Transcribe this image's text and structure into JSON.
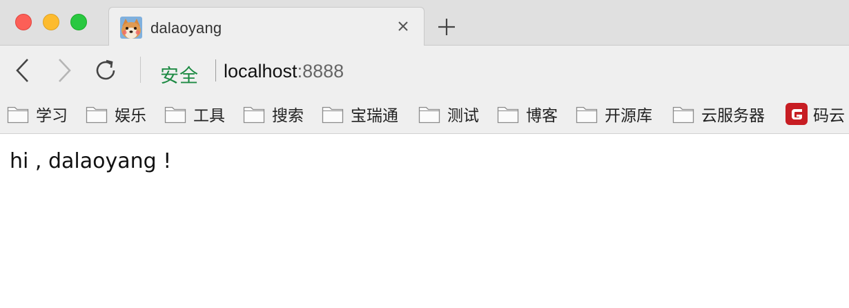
{
  "tab": {
    "title": "dalaoyang",
    "close_symbol": "×",
    "favicon": "shiba-dog-favicon"
  },
  "new_tab_symbol": "+",
  "toolbar": {
    "back_icon": "chevron-left-icon",
    "forward_icon": "chevron-right-icon",
    "reload_icon": "reload-icon"
  },
  "omnibox": {
    "security_label": "安全",
    "url_host": "localhost",
    "url_port": ":8888"
  },
  "bookmarks": [
    {
      "label": "学习",
      "icon": "folder-icon"
    },
    {
      "label": "娱乐",
      "icon": "folder-icon"
    },
    {
      "label": "工具",
      "icon": "folder-icon"
    },
    {
      "label": "搜索",
      "icon": "folder-icon"
    },
    {
      "label": "宝瑞通",
      "icon": "folder-icon"
    },
    {
      "label": "测试",
      "icon": "folder-icon"
    },
    {
      "label": "博客",
      "icon": "folder-icon"
    },
    {
      "label": "开源库",
      "icon": "folder-icon"
    },
    {
      "label": "云服务器",
      "icon": "folder-icon"
    },
    {
      "label": "码云",
      "icon": "gitee-logo-icon"
    }
  ],
  "page": {
    "text": "hi , dalaoyang !"
  },
  "colors": {
    "secure_green": "#1d8a43",
    "close_red": "#fc5f57",
    "minimize_yellow": "#fdbb2e",
    "maximize_green": "#29c840",
    "gitee_red": "#c71d23"
  }
}
